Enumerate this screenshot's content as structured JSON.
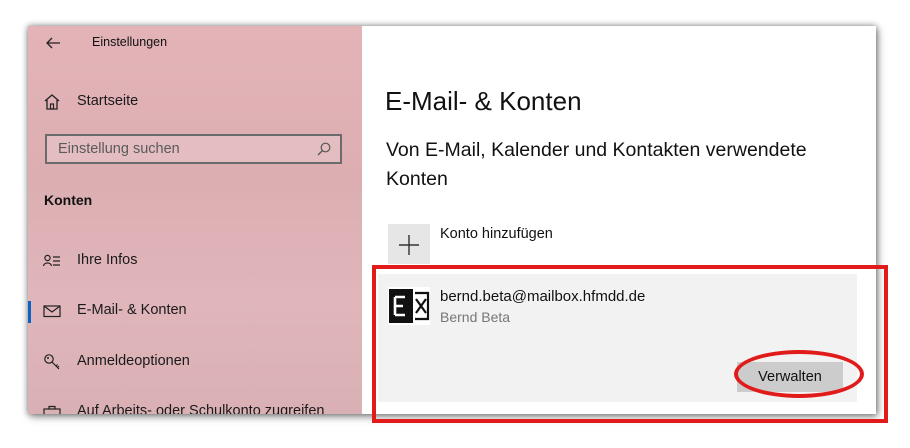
{
  "titlebar": {
    "back_icon": "back-arrow-icon",
    "title": "Einstellungen"
  },
  "sidebar": {
    "home_label": "Startseite",
    "search_placeholder": "Einstellung suchen",
    "section_title": "Konten",
    "items": [
      {
        "icon": "person-list-icon",
        "label": "Ihre Infos",
        "active": false
      },
      {
        "icon": "mail-icon",
        "label": "E-Mail- & Konten",
        "active": true
      },
      {
        "icon": "key-icon",
        "label": "Anmeldeoptionen",
        "active": false
      },
      {
        "icon": "briefcase-icon",
        "label": "Auf Arbeits- oder Schulkonto zugreifen",
        "active": false
      }
    ]
  },
  "main": {
    "title": "E-Mail- & Konten",
    "subtitle": "Von E-Mail, Kalender und Kontakten verwendete Konten",
    "add_account_label": "Konto hinzufügen",
    "account": {
      "icon": "exchange-icon",
      "email": "bernd.beta@mailbox.hfmdd.de",
      "name": "Bernd Beta",
      "manage_label": "Verwalten"
    }
  },
  "annotation": {
    "highlight_color": "#e11a1a"
  },
  "colors": {
    "accent": "#0b64c0",
    "card_bg": "#f2f2f2",
    "button_bg": "#cccccc"
  }
}
